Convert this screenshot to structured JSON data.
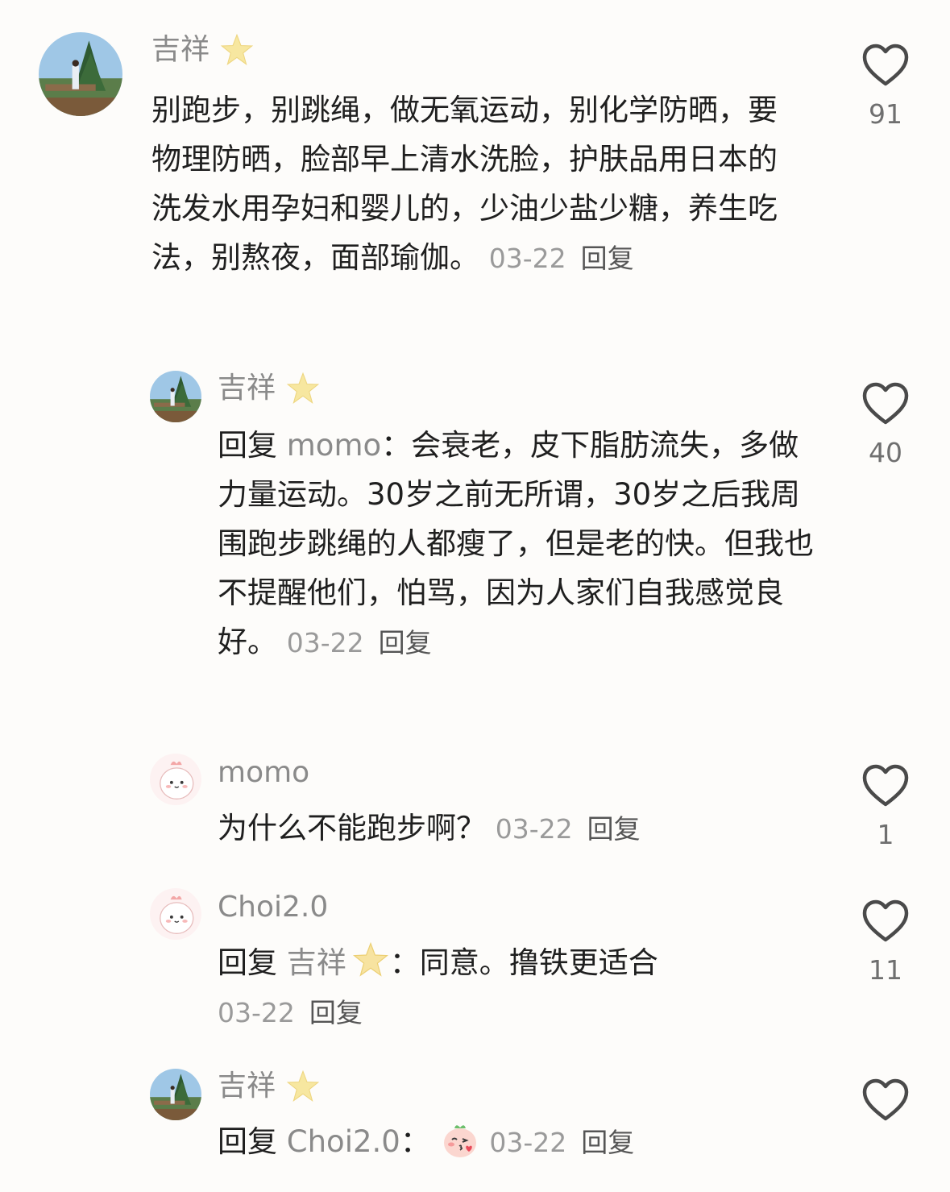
{
  "comments": [
    {
      "username": "吉祥",
      "badge_icon": "star-icon",
      "text": "别跑步，别跳绳，做无氧运动，别化学防晒，要物理防晒，脸部早上清水洗脸，护肤品用日本的洗发水用孕妇和婴儿的，少油少盐少糖，养生吃法，别熬夜，面部瑜伽。",
      "date": "03-22",
      "reply_label": "回复",
      "likes": "91"
    },
    {
      "username": "吉祥",
      "badge_icon": "star-icon",
      "reply_prefix": "回复",
      "reply_to": "momo",
      "colon": "：",
      "text": "会衰老，皮下脂肪流失，多做力量运动。30岁之前无所谓，30岁之后我周围跑步跳绳的人都瘦了，但是老的快。但我也不提醒他们，怕骂，因为人家们自我感觉良好。",
      "date": "03-22",
      "reply_label": "回复",
      "likes": "40"
    },
    {
      "username": "momo",
      "text": "为什么不能跑步啊？",
      "date": "03-22",
      "reply_label": "回复",
      "likes": "1"
    },
    {
      "username": "Choi2.0",
      "reply_prefix": "回复",
      "reply_to": "吉祥",
      "reply_to_badge": "star-icon",
      "colon": "：",
      "text": "同意。撸铁更适合",
      "date": "03-22",
      "reply_label": "回复",
      "likes": "11"
    },
    {
      "username": "吉祥",
      "badge_icon": "star-icon",
      "reply_prefix": "回复",
      "reply_to": "Choi2.0",
      "colon": "：",
      "emoji": "kiss-face-emoji",
      "date": "03-22",
      "reply_label": "回复"
    }
  ]
}
